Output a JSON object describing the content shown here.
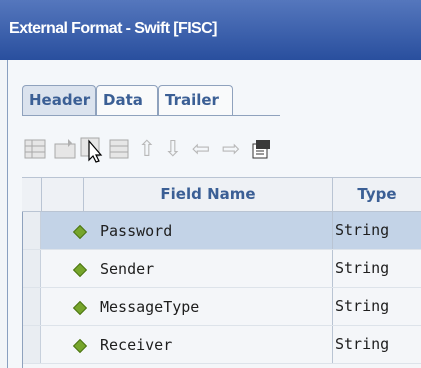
{
  "window": {
    "title": "External Format - Swift [FISC]"
  },
  "tabs": [
    {
      "label": "Header",
      "active": true
    },
    {
      "label": "Data",
      "active": false
    },
    {
      "label": "Trailer",
      "active": false
    }
  ],
  "toolbar": {
    "icons": [
      "add-row-icon",
      "insert-icon",
      "edit-icon",
      "move-up-icon",
      "move-down-icon",
      "move-left-icon",
      "move-right-icon",
      "properties-icon"
    ]
  },
  "grid": {
    "columns": [
      "Field Name",
      "Type"
    ],
    "rows": [
      {
        "name": "Password",
        "type": "String",
        "selected": true
      },
      {
        "name": "Sender",
        "type": "String",
        "selected": false
      },
      {
        "name": "MessageType",
        "type": "String",
        "selected": false
      },
      {
        "name": "Receiver",
        "type": "String",
        "selected": false
      }
    ]
  },
  "colors": {
    "title_bar": "#294f9e",
    "accent_text": "#3b5f95",
    "selected_row": "#c3d3e7",
    "field_icon": "#76a52b"
  }
}
